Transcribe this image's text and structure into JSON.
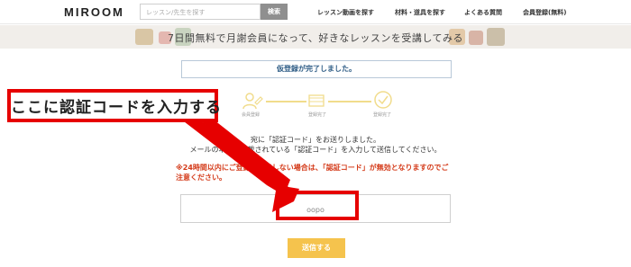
{
  "header": {
    "logo": "MIROOM",
    "search_placeholder": "レッスン/先生を探す",
    "search_button": "検索",
    "nav": [
      "レッスン動画を探す",
      "材料・道具を探す",
      "よくある質問",
      "会員登録(無料)"
    ]
  },
  "banner": {
    "text": "7日間無料で月謝会員になって、好きなレッスンを受講してみる"
  },
  "notice": {
    "text": "仮登録が完了しました。"
  },
  "steps": {
    "labels": [
      "会員登録",
      "登録完了",
      "登録完了"
    ]
  },
  "messages": {
    "line1": "宛に「認証コード」をお送りしました。",
    "line2": "メールの本文に記載されている「認証コード」を入力して送信してください。",
    "warning_line1": "※24時間以内にご登録が完了しない場合は、「認証コード」が無効となりますのでご",
    "warning_line2": "注意ください。"
  },
  "code_input": {
    "value": "oopo"
  },
  "submit": {
    "label": "送信する"
  },
  "annotation": {
    "callout_text": "ここに認証コードを入力する"
  },
  "colors": {
    "accent": "#f5c34d",
    "warning": "#d43b1a",
    "annotation": "#e60000",
    "notice_text": "#2f5d86"
  }
}
